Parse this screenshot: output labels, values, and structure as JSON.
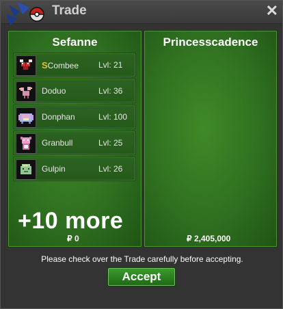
{
  "window": {
    "title": "Trade",
    "close_icon": "close-icon"
  },
  "left_panel": {
    "player": "Sefanne",
    "pokemon": [
      {
        "shiny_mark": "S",
        "name": "Combee",
        "level": "Lvl: 21",
        "icon": "combee-sprite"
      },
      {
        "shiny_mark": "",
        "name": "Doduo",
        "level": "Lvl: 36",
        "icon": "doduo-sprite"
      },
      {
        "shiny_mark": "",
        "name": "Donphan",
        "level": "Lvl: 100",
        "icon": "donphan-sprite"
      },
      {
        "shiny_mark": "",
        "name": "Granbull",
        "level": "Lvl: 25",
        "icon": "granbull-sprite"
      },
      {
        "shiny_mark": "",
        "name": "Gulpin",
        "level": "Lvl: 26",
        "icon": "gulpin-sprite"
      }
    ],
    "more_label": "+10 more",
    "money": "₽ 0"
  },
  "right_panel": {
    "player": "Princesscadence",
    "money": "₽ 2,405,000"
  },
  "notice": "Please check over the Trade carefully before accepting.",
  "accept_label": "Accept",
  "colors": {
    "panel_green": "#2f7020",
    "accent": "#3a9a2c",
    "shiny": "#e8c02a"
  }
}
